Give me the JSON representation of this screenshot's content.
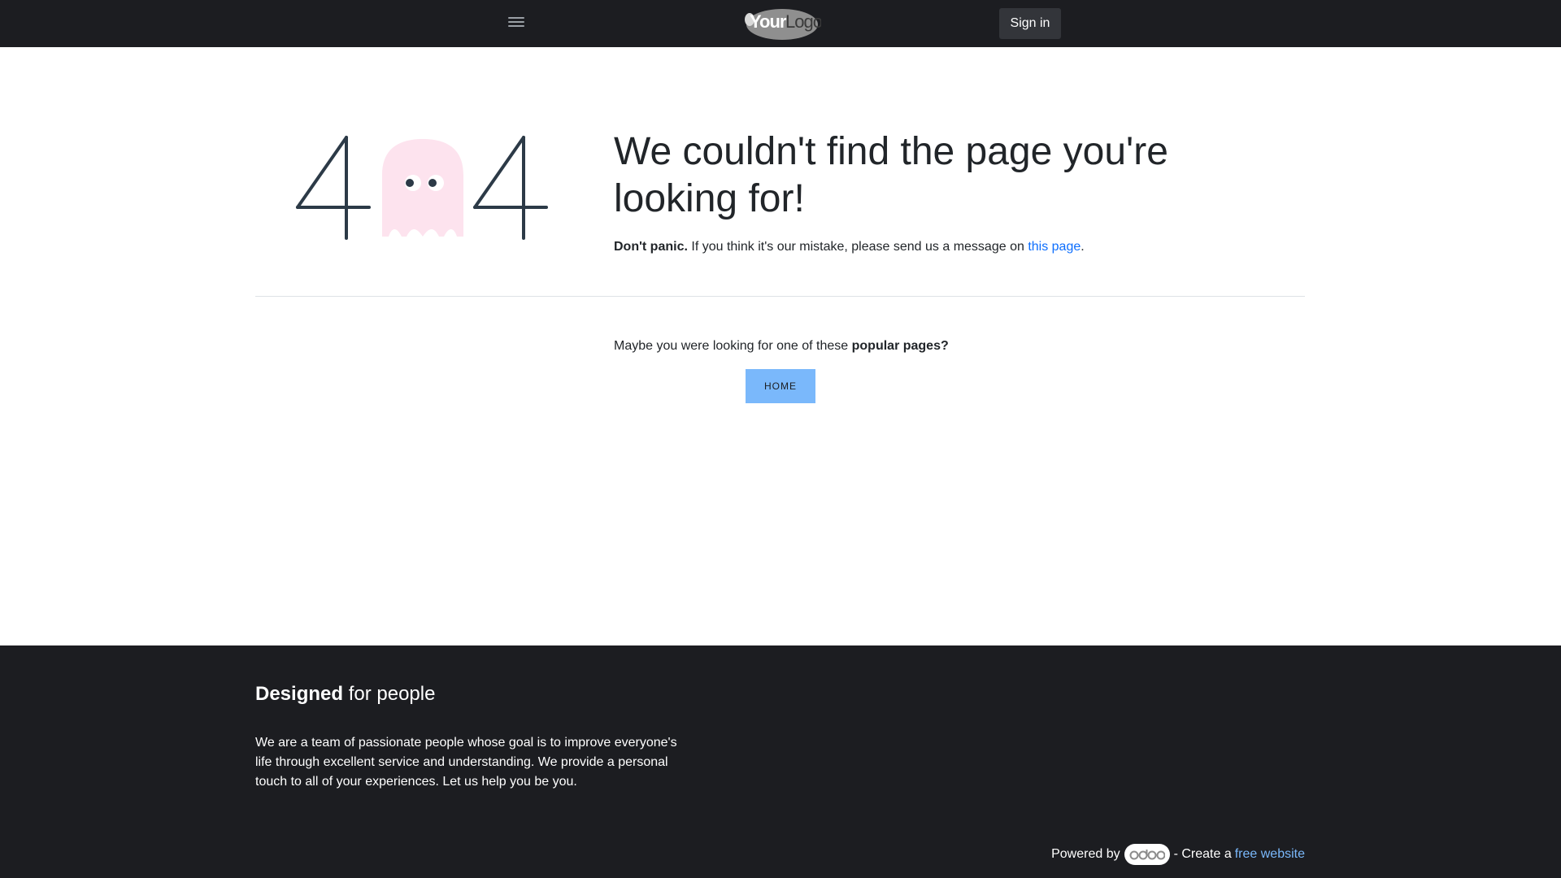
{
  "header": {
    "logo_text": "YourLogo",
    "signin_label": "Sign in"
  },
  "error": {
    "digit_left": "4",
    "digit_right": "4",
    "title": "We couldn't find the page you're looking for!",
    "msg_bold": "Don't panic.",
    "msg_text": " If you think it's our mistake, please send us a message on ",
    "msg_link": "this page",
    "msg_end": "."
  },
  "popular": {
    "text": "Maybe you were looking for one of these ",
    "bold": "popular pages?",
    "home_label": "HOME"
  },
  "footer": {
    "heading_bold": "Designed",
    "heading_rest": " for people",
    "about": "We are a team of passionate people whose goal is to improve everyone's life through excellent service and understanding. We provide a personal touch to all of your experiences. Let us help you be you.",
    "powered_by": "Powered by",
    "odoo_logo": "odoo",
    "create_text": " - Create a",
    "free_link": "free website"
  },
  "colors": {
    "header_bg": "#1c1d21",
    "ghost": "#fde3ee",
    "digit": "#2c3a47",
    "accent": "#7ab8fb",
    "link": "#0d6efd"
  }
}
